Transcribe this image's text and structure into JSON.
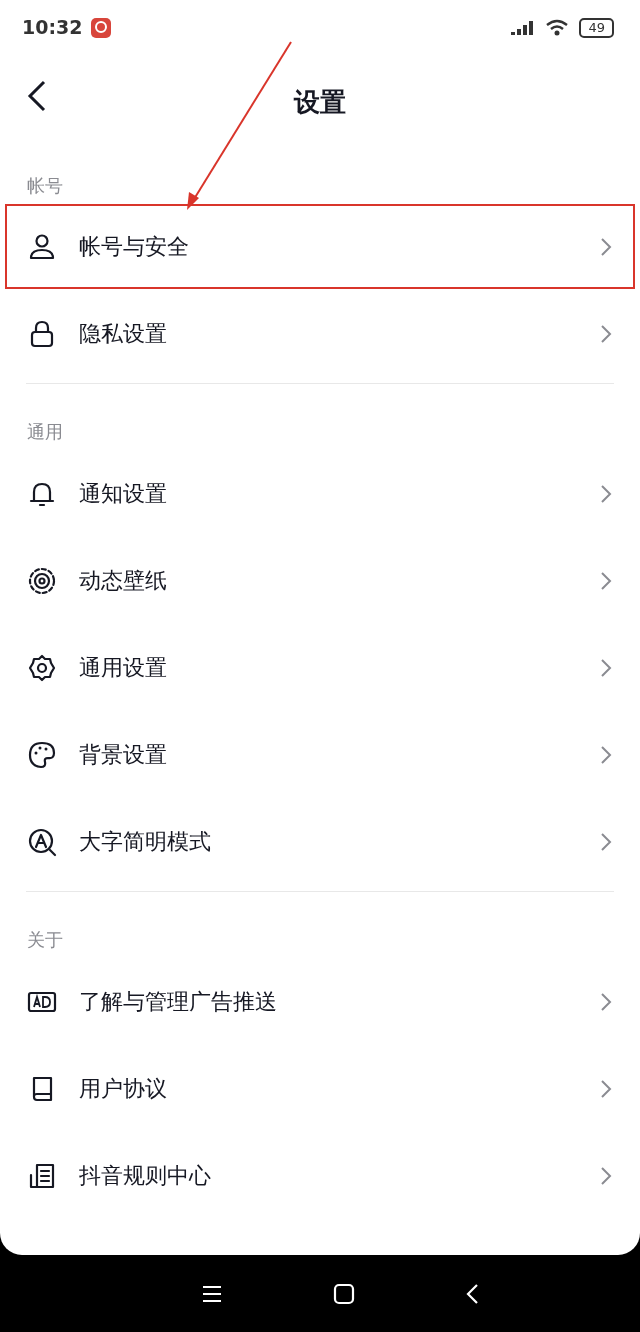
{
  "status_bar": {
    "time": "10:32",
    "battery": "49"
  },
  "header": {
    "title": "设置"
  },
  "sections": [
    {
      "label": "帐号",
      "items": [
        {
          "label": "帐号与安全",
          "highlighted": true
        },
        {
          "label": "隐私设置",
          "highlighted": false
        }
      ]
    },
    {
      "label": "通用",
      "items": [
        {
          "label": "通知设置",
          "highlighted": false
        },
        {
          "label": "动态壁纸",
          "highlighted": false
        },
        {
          "label": "通用设置",
          "highlighted": false
        },
        {
          "label": "背景设置",
          "highlighted": false
        },
        {
          "label": "大字简明模式",
          "highlighted": false
        }
      ]
    },
    {
      "label": "关于",
      "items": [
        {
          "label": "了解与管理广告推送",
          "highlighted": false
        },
        {
          "label": "用户协议",
          "highlighted": false
        },
        {
          "label": "抖音规则中心",
          "highlighted": false
        }
      ]
    }
  ]
}
